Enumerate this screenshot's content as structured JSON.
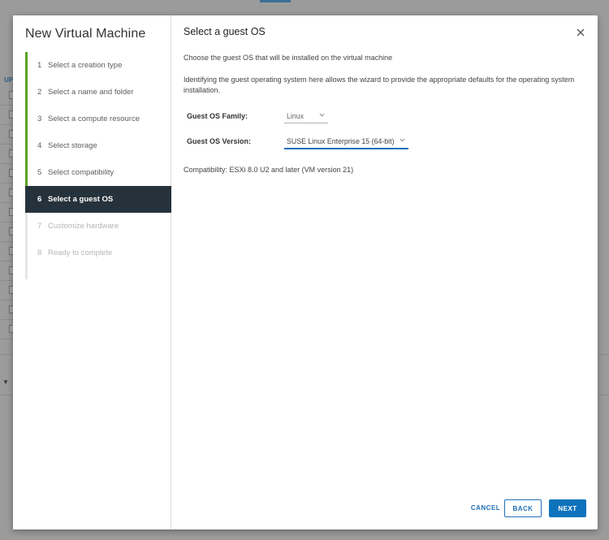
{
  "background": {
    "up_label": "UP"
  },
  "wizard": {
    "title": "New Virtual Machine",
    "steps": [
      {
        "num": "1",
        "label": "Select a creation type",
        "state": "done"
      },
      {
        "num": "2",
        "label": "Select a name and folder",
        "state": "done"
      },
      {
        "num": "3",
        "label": "Select a compute resource",
        "state": "done"
      },
      {
        "num": "4",
        "label": "Select storage",
        "state": "done"
      },
      {
        "num": "5",
        "label": "Select compatibility",
        "state": "done"
      },
      {
        "num": "6",
        "label": "Select a guest OS",
        "state": "active"
      },
      {
        "num": "7",
        "label": "Customize hardware",
        "state": "disabled"
      },
      {
        "num": "8",
        "label": "Ready to complete",
        "state": "disabled"
      }
    ]
  },
  "page": {
    "title": "Select a guest OS",
    "intro": "Choose the guest OS that will be installed on the virtual machine",
    "description": "Identifying the guest operating system here allows the wizard to provide the appropriate defaults for the operating system installation.",
    "family_label": "Guest OS Family:",
    "family_value": "Linux",
    "version_label": "Guest OS Version:",
    "version_value": "SUSE Linux Enterprise 15 (64-bit)",
    "compatibility": "Compatibility: ESXi 8.0 U2 and later (VM version 21)"
  },
  "buttons": {
    "cancel": "CANCEL",
    "back": "BACK",
    "next": "NEXT"
  },
  "colors": {
    "accent": "#0e72bc",
    "done_bar": "#5aa220",
    "active_bg": "#26323b"
  }
}
